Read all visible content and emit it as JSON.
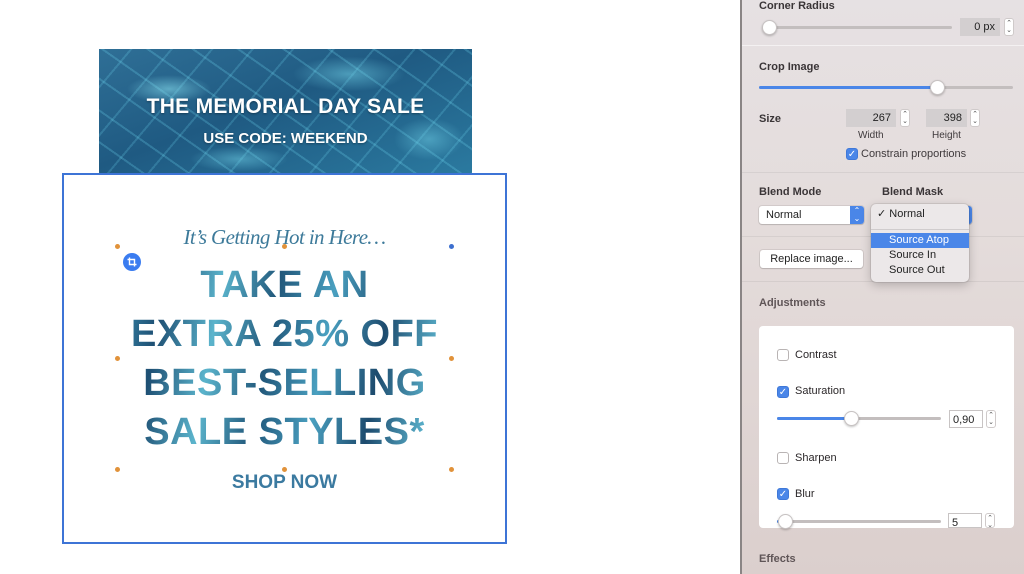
{
  "canvas": {
    "banner": {
      "title": "THE MEMORIAL DAY SALE",
      "subtitle": "USE CODE: WEEKEND"
    },
    "card": {
      "tagline": "It’s Getting Hot in Here…",
      "headline_lines": [
        "TAKE AN",
        "EXTRA 25% OFF",
        "BEST-SELLING",
        "SALE STYLES*"
      ],
      "cta": "SHOP NOW"
    }
  },
  "inspector": {
    "corner_radius": {
      "label": "Corner Radius",
      "value": "0 px",
      "slider_fraction": 0.0
    },
    "crop_image": {
      "label": "Crop Image",
      "slider_fraction": 0.7
    },
    "size": {
      "label": "Size",
      "width": "267",
      "width_label": "Width",
      "height": "398",
      "height_label": "Height",
      "constrain_label": "Constrain proportions",
      "constrain_checked": true
    },
    "blend_mode": {
      "label": "Blend Mode",
      "value": "Normal"
    },
    "blend_mask": {
      "label": "Blend Mask",
      "value": "Normal",
      "menu": {
        "checked_item": "Normal",
        "items": [
          "Source Atop",
          "Source In",
          "Source Out"
        ],
        "highlighted": "Source Atop"
      }
    },
    "replace_image_label": "Replace image...",
    "adjustments": {
      "label": "Adjustments",
      "contrast": {
        "label": "Contrast",
        "checked": false
      },
      "saturation": {
        "label": "Saturation",
        "checked": true,
        "value": "0,90",
        "slider_fraction": 0.45
      },
      "sharpen": {
        "label": "Sharpen",
        "checked": false
      },
      "blur": {
        "label": "Blur",
        "checked": true,
        "value": "5",
        "slider_fraction": 0.05
      }
    },
    "effects_label": "Effects",
    "colors": {
      "accent": "#4a86e8",
      "selection": "#3d74d6",
      "handle": "#e1923a"
    }
  }
}
